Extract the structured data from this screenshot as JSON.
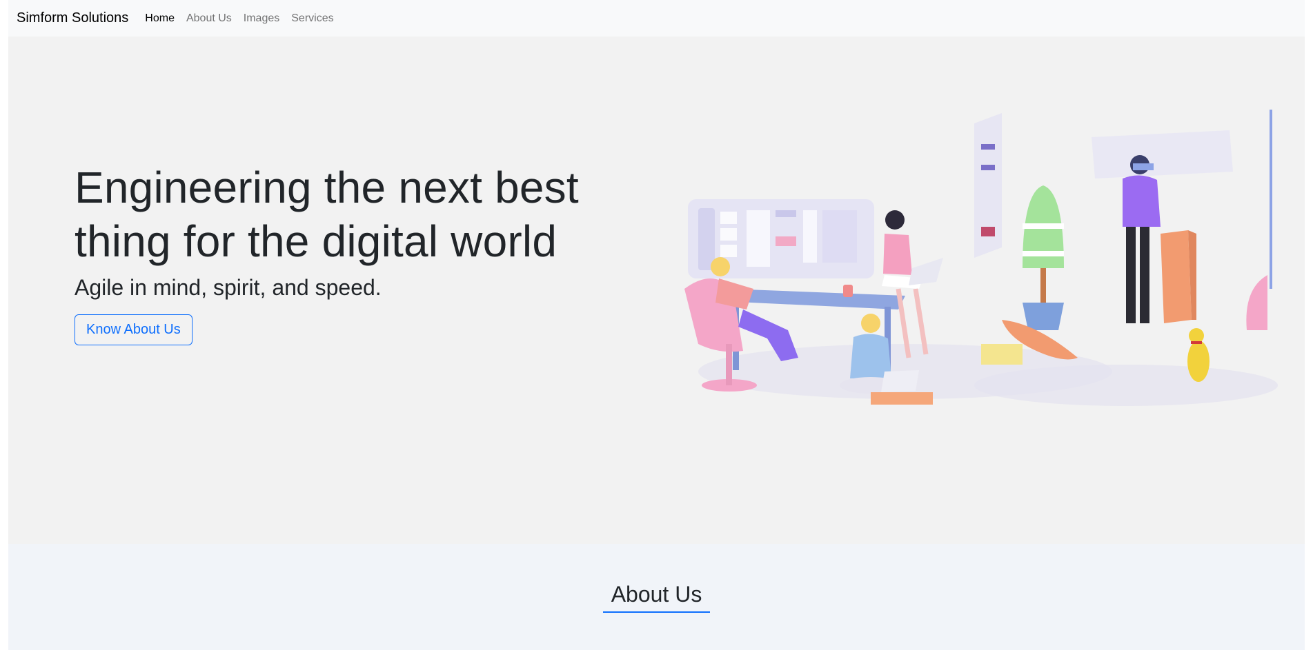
{
  "navbar": {
    "brand": "Simform Solutions",
    "links": [
      {
        "label": "Home",
        "active": true
      },
      {
        "label": "About Us",
        "active": false
      },
      {
        "label": "Images",
        "active": false
      },
      {
        "label": "Services",
        "active": false
      }
    ]
  },
  "hero": {
    "title_line1": "Engineering the next best",
    "title_line2": "thing for the digital world",
    "subtitle": "Agile in mind, spirit, and speed.",
    "button_label": "Know About Us"
  },
  "about": {
    "title": "About Us"
  },
  "colors": {
    "primary": "#0d6efd",
    "navbar_bg": "#f8f9fa",
    "hero_bg": "#f2f2f2",
    "about_bg": "#f1f4f9"
  }
}
